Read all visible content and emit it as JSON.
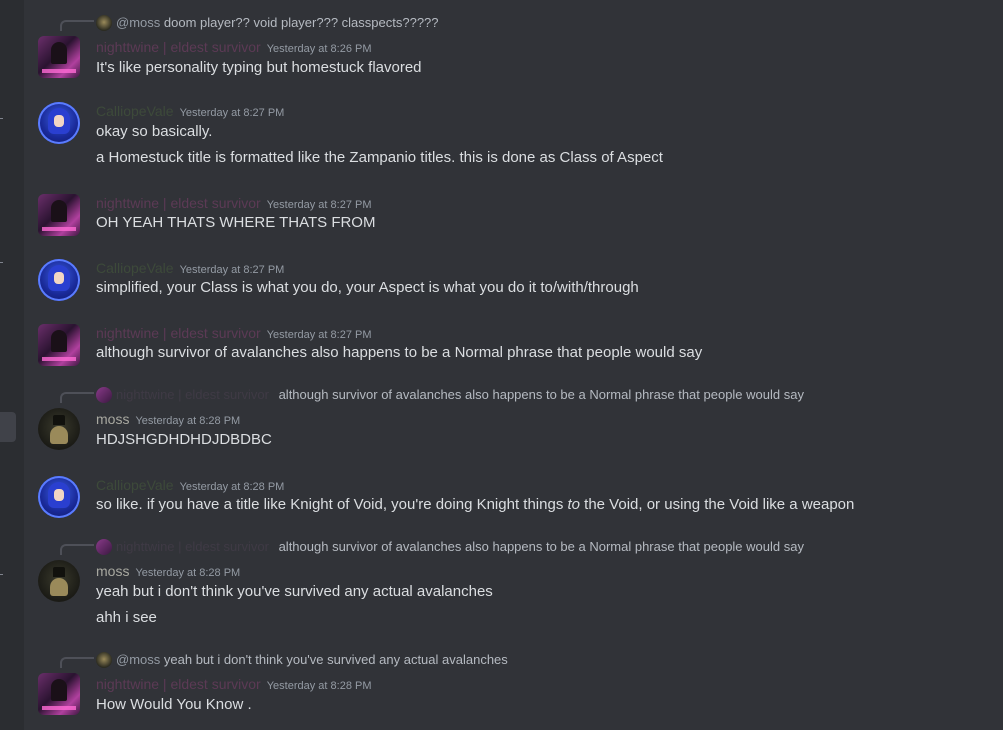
{
  "messages": [
    {
      "reply": {
        "mention": "@moss",
        "text": "doom player?? void player??? classpects?????"
      },
      "author": "nighttwine | eldest survivor",
      "timestamp": "Yesterday at 8:26 PM",
      "lines": [
        "It's like personality typing but homestuck flavored"
      ]
    },
    {
      "author": "CalliopeVale",
      "timestamp": "Yesterday at 8:27 PM",
      "lines": [
        "okay so basically.",
        "a Homestuck title is formatted like the Zampanio titles. this is done as Class of Aspect"
      ]
    },
    {
      "author": "nighttwine | eldest survivor",
      "timestamp": "Yesterday at 8:27 PM",
      "lines": [
        "OH YEAH THATS WHERE THATS FROM"
      ]
    },
    {
      "author": "CalliopeVale",
      "timestamp": "Yesterday at 8:27 PM",
      "lines": [
        "simplified, your Class is what you do, your Aspect is what you do it to/with/through"
      ]
    },
    {
      "author": "nighttwine | eldest survivor",
      "timestamp": "Yesterday at 8:27 PM",
      "lines": [
        "although survivor of avalanches also happens to be a Normal phrase that people would say"
      ]
    },
    {
      "reply": {
        "name": "nighttwine | eldest survivor",
        "text": "although survivor of avalanches also happens to be a Normal phrase that people would say"
      },
      "author": "moss",
      "timestamp": "Yesterday at 8:28 PM",
      "lines": [
        "HDJSHGDHDHDJDBDBC"
      ]
    },
    {
      "author": "CalliopeVale",
      "timestamp": "Yesterday at 8:28 PM",
      "line_parts": [
        "so like. if you have a title like Knight of Void, you're doing Knight things ",
        "to",
        " the Void, or using the Void like a weapon"
      ]
    },
    {
      "reply": {
        "name": "nighttwine | eldest survivor",
        "text": "although survivor of avalanches also happens to be a Normal phrase that people would say"
      },
      "author": "moss",
      "timestamp": "Yesterday at 8:28 PM",
      "lines": [
        "yeah but i don't think you've survived any actual avalanches",
        "ahh i see"
      ]
    },
    {
      "reply": {
        "mention": "@moss",
        "text": "yeah but i don't think you've survived any actual avalanches"
      },
      "author": "nighttwine | eldest survivor",
      "timestamp": "Yesterday at 8:28 PM",
      "lines": [
        "How Would You Know ."
      ]
    }
  ]
}
